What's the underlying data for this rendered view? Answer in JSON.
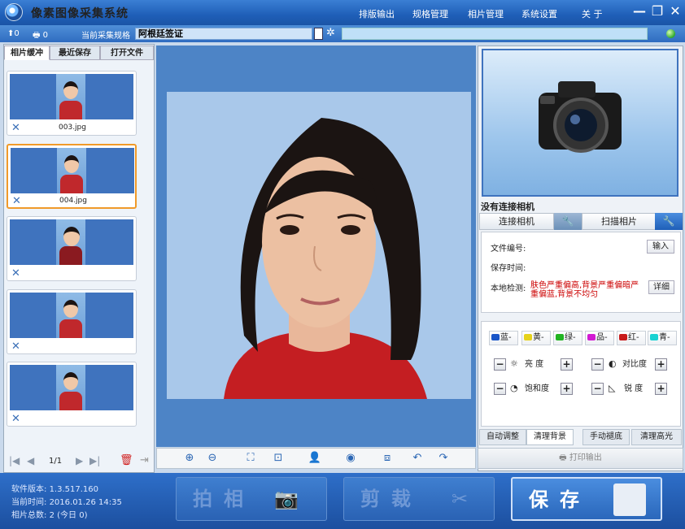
{
  "window": {
    "title": "像素图像采集系统",
    "menu": [
      "排版输出",
      "规格管理",
      "相片管理",
      "系统设置",
      "关 于"
    ]
  },
  "toolbar": {
    "upload_count": "0",
    "print_count": "0",
    "spec_label": "当前采集规格",
    "spec_value": "阿根廷签证"
  },
  "left": {
    "tabs": [
      "相片缓冲",
      "最近保存",
      "打开文件"
    ],
    "thumbs": [
      {
        "name": "003.jpg",
        "selected": false
      },
      {
        "name": "004.jpg",
        "selected": true
      },
      {
        "name": "",
        "selected": false
      },
      {
        "name": "",
        "selected": false
      },
      {
        "name": "",
        "selected": false
      }
    ],
    "page": "1/1"
  },
  "right": {
    "camera_status": "没有连接相机",
    "connect_label": "连接相机",
    "scan_label": "扫描相片",
    "file_no_label": "文件编号:",
    "input_btn": "输入",
    "save_time_label": "保存时间:",
    "local_check_label": "本地检测:",
    "local_check_result": "肤色严重偏高,背景严重偏暗严重偏蓝,背景不均匀",
    "detail_btn": "详细",
    "colors": [
      {
        "label": "蓝-",
        "color": "#1a56c8"
      },
      {
        "label": "黄-",
        "color": "#e6d21a"
      },
      {
        "label": "绿-",
        "color": "#22b422"
      },
      {
        "label": "品-",
        "color": "#d21ad2"
      },
      {
        "label": "红-",
        "color": "#c81a1a"
      },
      {
        "label": "青-",
        "color": "#1ad2d2"
      }
    ],
    "adjust": {
      "brightness": "亮 度",
      "contrast": "对比度",
      "saturation": "饱和度",
      "sharpness": "锐 度"
    },
    "tabs": [
      "自动调整",
      "清理背景",
      "手动褪底",
      "清理高光"
    ],
    "print_label": "打印输出"
  },
  "status": {
    "version_label": "软件版本:",
    "version": "1.3.517.160",
    "time_label": "当前时间:",
    "time": "2016.01.26 14:35",
    "total_label": "相片总数:",
    "total": "2",
    "today": "(今日 0)"
  },
  "actions": {
    "shoot": "拍相",
    "crop": "剪裁",
    "save": "保存"
  }
}
